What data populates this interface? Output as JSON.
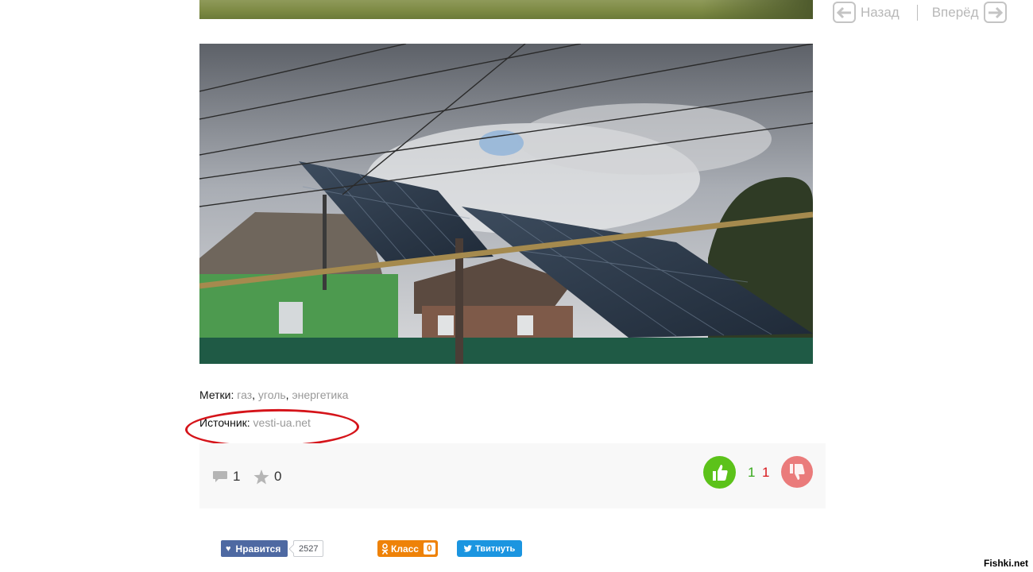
{
  "nav": {
    "back_label": "Назад",
    "forward_label": "Вперёд"
  },
  "article": {
    "tags_label": "Метки:",
    "tags": [
      "газ",
      "уголь",
      "энергетика"
    ],
    "tag_separator": ", ",
    "source_label": "Источник:",
    "source_link": "vesti-ua.net"
  },
  "stats": {
    "comments": "1",
    "favorites": "0",
    "votes_up": "1",
    "votes_down": "1"
  },
  "social": {
    "fb_label": "Нравится",
    "fb_count": "2527",
    "ok_label": "Класс",
    "ok_count": "0",
    "tw_label": "Твитнуть"
  },
  "watermark": "Fishki.net",
  "icons": {
    "back": "arrow-left-icon",
    "forward": "arrow-right-icon",
    "comment": "comment-icon",
    "favorite": "star-icon",
    "like": "thumbs-up-icon",
    "dislike": "thumbs-down-icon",
    "fb": "heart-icon",
    "ok": "odnoklassniki-icon",
    "tw": "twitter-bird-icon"
  },
  "colors": {
    "vote_up": "#5cc21a",
    "vote_down": "#ea7b7b",
    "highlight_ellipse": "#d5141a",
    "link": "#999999"
  }
}
